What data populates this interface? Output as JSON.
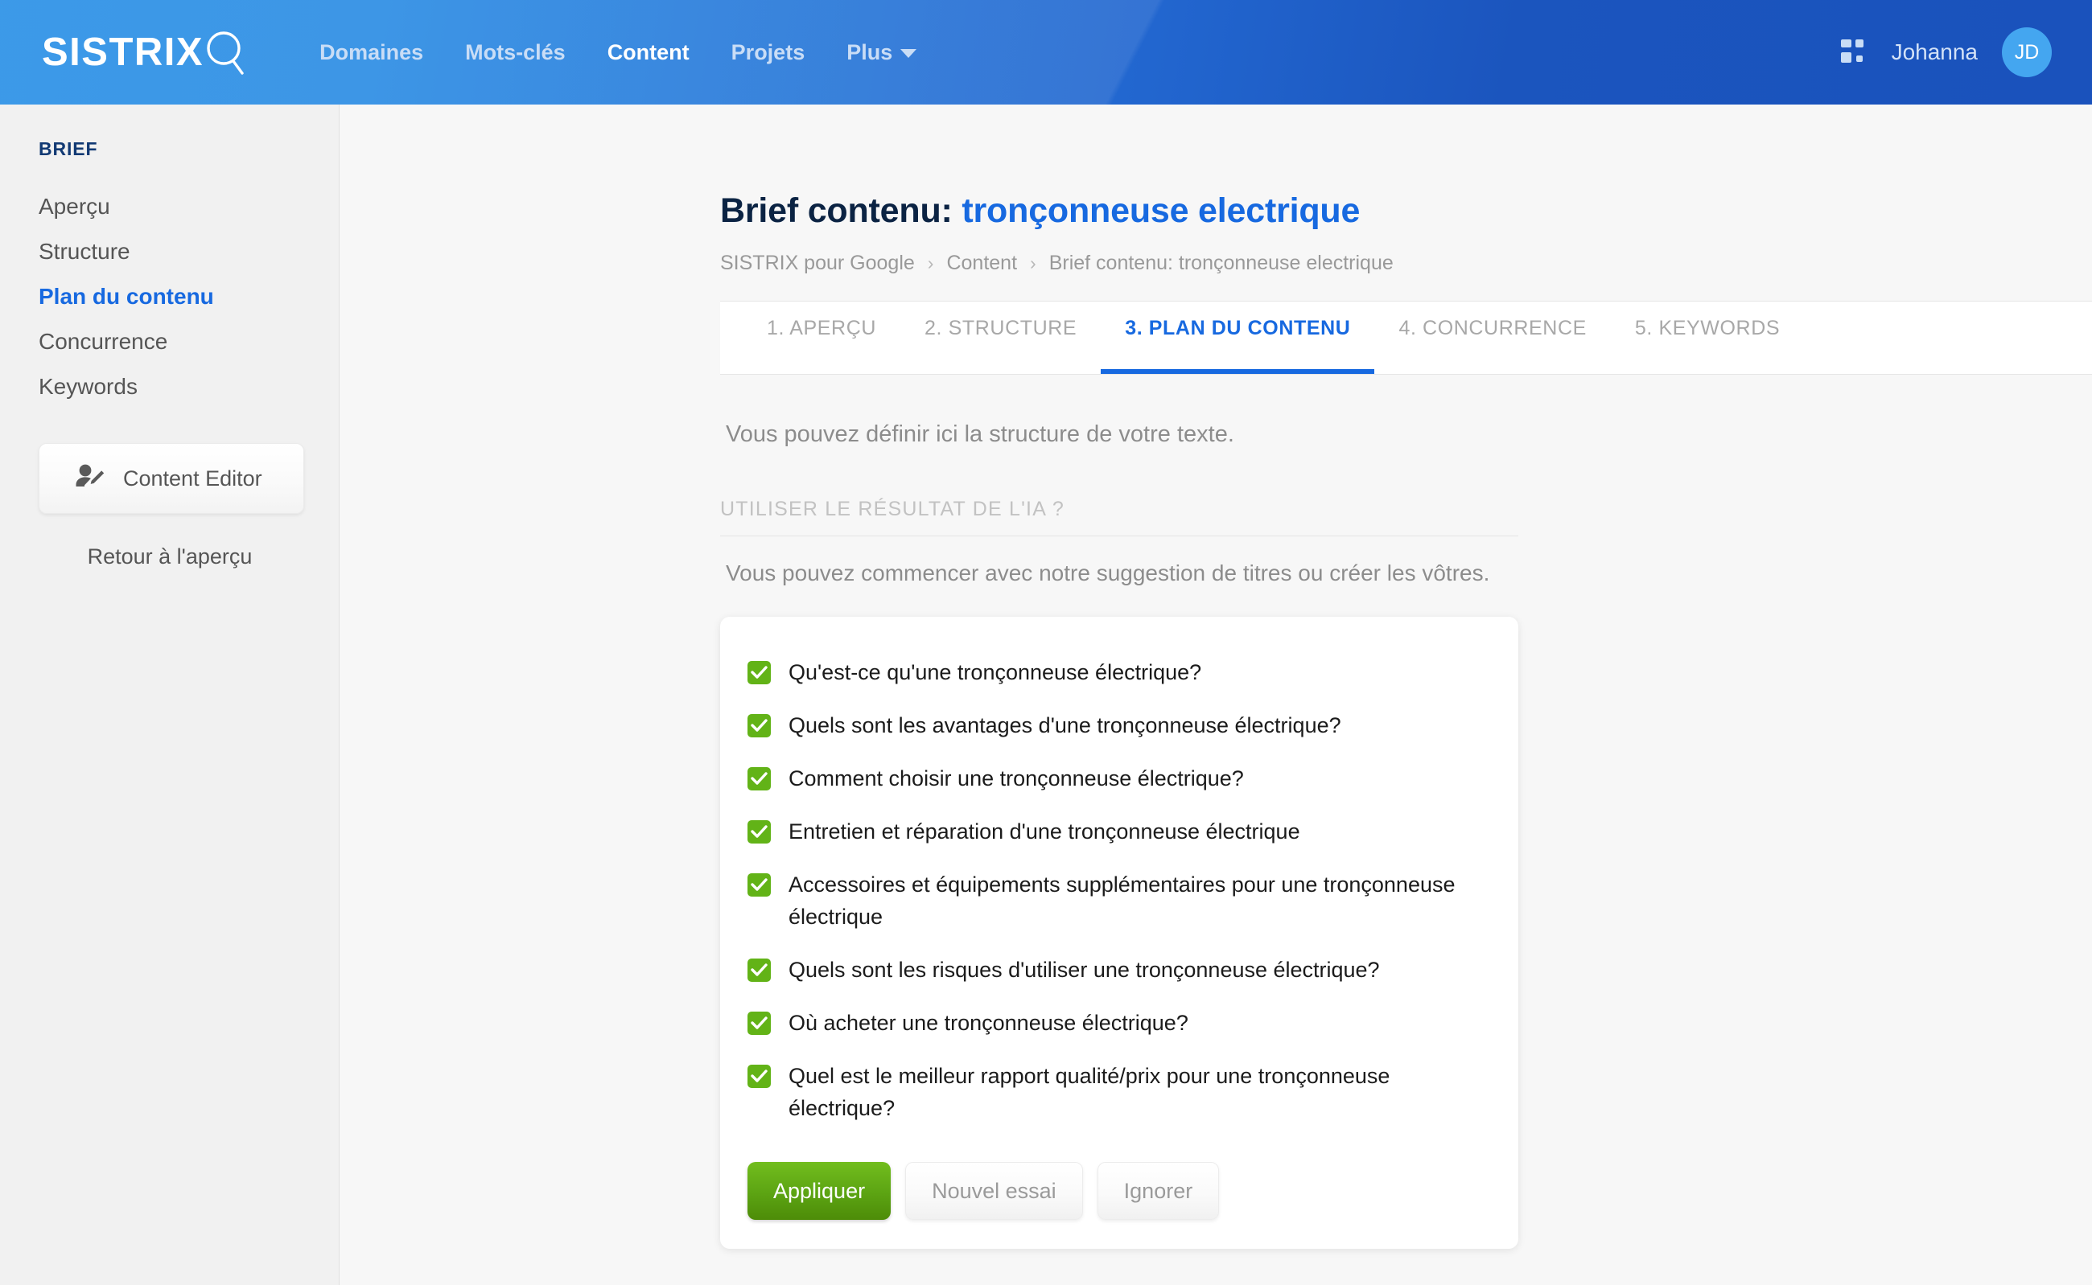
{
  "header": {
    "brand": "SISTRIX",
    "brand_icon": "magnifier-icon",
    "nav": [
      {
        "label": "Domaines",
        "active": false
      },
      {
        "label": "Mots-clés",
        "active": false
      },
      {
        "label": "Content",
        "active": true
      },
      {
        "label": "Projets",
        "active": false
      },
      {
        "label": "Plus",
        "active": false,
        "caret": true
      }
    ],
    "apps_icon": "apps-grid-icon",
    "user_name": "Johanna",
    "avatar_initials": "JD"
  },
  "sidebar": {
    "title": "BRIEF",
    "items": [
      {
        "label": "Aperçu",
        "active": false
      },
      {
        "label": "Structure",
        "active": false
      },
      {
        "label": "Plan du contenu",
        "active": true
      },
      {
        "label": "Concurrence",
        "active": false
      },
      {
        "label": "Keywords",
        "active": false
      }
    ],
    "content_editor_button": "Content Editor",
    "content_editor_icon": "user-edit-icon",
    "back_link": "Retour à l'aperçu"
  },
  "page": {
    "title_prefix": "Brief contenu:",
    "title_keyword": "tronçonneuse electrique",
    "breadcrumb": [
      "SISTRIX pour Google",
      "Content",
      "Brief contenu: tronçonneuse electrique"
    ],
    "breadcrumb_separator": "›"
  },
  "tabs": [
    {
      "label": "1. APERÇU",
      "active": false
    },
    {
      "label": "2. STRUCTURE",
      "active": false
    },
    {
      "label": "3. PLAN DU CONTENU",
      "active": true
    },
    {
      "label": "4. CONCURRENCE",
      "active": false
    },
    {
      "label": "5. KEYWORDS",
      "active": false
    }
  ],
  "content": {
    "intro": "Vous pouvez définir ici la structure de votre texte.",
    "ai_section_heading": "UTILISER LE RÉSULTAT DE L'IA ?",
    "ai_section_sub": "Vous pouvez commencer avec notre suggestion de titres ou créer les vôtres.",
    "suggestions": [
      {
        "label": "Qu'est-ce qu'une tronçonneuse électrique?",
        "checked": true
      },
      {
        "label": "Quels sont les avantages d'une tronçonneuse électrique?",
        "checked": true
      },
      {
        "label": "Comment choisir une tronçonneuse électrique?",
        "checked": true
      },
      {
        "label": "Entretien et réparation d'une tronçonneuse électrique",
        "checked": true
      },
      {
        "label": "Accessoires et équipements supplémentaires pour une tronçonneuse électrique",
        "checked": true
      },
      {
        "label": "Quels sont les risques d'utiliser une tronçonneuse électrique?",
        "checked": true
      },
      {
        "label": "Où acheter une tronçonneuse électrique?",
        "checked": true
      },
      {
        "label": "Quel est le meilleur rapport qualité/prix pour une tronçonneuse électrique?",
        "checked": true
      }
    ],
    "actions": {
      "apply": "Appliquer",
      "retry": "Nouvel essai",
      "ignore": "Ignorer"
    }
  },
  "help": {
    "icon": "question-mark-icon",
    "label": "?"
  },
  "colors": {
    "brand_blue": "#1769e0",
    "header_light": "#2a90e6",
    "header_dark": "#1a52bc",
    "accent_green": "#62b317",
    "button_green": "#5da513",
    "title_navy": "#0b2343"
  }
}
